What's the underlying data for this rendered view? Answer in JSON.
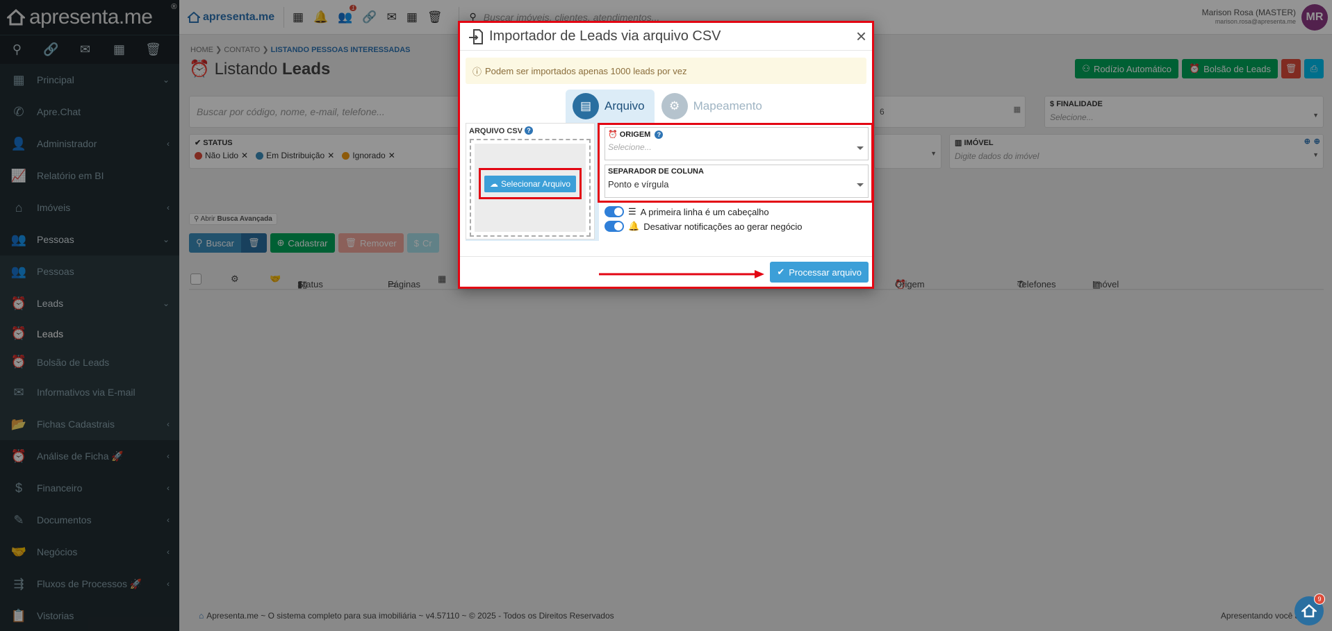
{
  "brand": {
    "name": "apresenta.me",
    "reg": "®"
  },
  "sidebar": {
    "tools": [
      "search-icon",
      "link-icon",
      "mail-icon",
      "calendar-icon",
      "trash-icon"
    ],
    "items": [
      {
        "label": "Principal",
        "icon": "dashboard-icon"
      },
      {
        "label": "Apre.Chat",
        "icon": "whatsapp-icon"
      },
      {
        "label": "Administrador",
        "icon": "user-icon"
      },
      {
        "label": "Relatório em BI",
        "icon": "chart-icon"
      },
      {
        "label": "Imóveis",
        "icon": "home-icon"
      },
      {
        "label": "Pessoas",
        "icon": "people-icon"
      },
      {
        "label": "Pessoas",
        "icon": "people-icon"
      },
      {
        "label": "Leads",
        "icon": "alarm-icon"
      },
      {
        "label": "Leads",
        "icon": "alarm-icon"
      },
      {
        "label": "Bolsão de Leads",
        "icon": "alarm-icon"
      },
      {
        "label": "Informativos via E-mail",
        "icon": "mail-icon"
      },
      {
        "label": "Fichas Cadastrais",
        "icon": "folder-icon"
      },
      {
        "label": "Análise de Ficha 🚀",
        "icon": "alarm-icon"
      },
      {
        "label": "Financeiro",
        "icon": "dollar-icon"
      },
      {
        "label": "Documentos",
        "icon": "document-icon"
      },
      {
        "label": "Negócios",
        "icon": "handshake-icon"
      },
      {
        "label": "Fluxos de Processos 🚀",
        "icon": "flow-icon"
      },
      {
        "label": "Vistorias",
        "icon": "clipboard-icon"
      }
    ]
  },
  "topbar": {
    "logo": "apresenta.me",
    "notif_badge": "1",
    "search_placeholder": "Buscar imóveis, clientes, atendimentos...",
    "user_name": "Marison Rosa (MASTER)",
    "user_email": "marison.rosa@apresenta.me",
    "avatar": "MR"
  },
  "page": {
    "breadcrumb": [
      "HOME",
      "CONTATO",
      "LISTANDO PESSOAS INTERESSADAS"
    ],
    "title_prefix": "Listando",
    "title_bold": "Leads",
    "rodizio": "Rodízio Automático",
    "bolsao": "Bolsão de Leads",
    "search_placeholder": "Buscar por código, nome, e-mail, telefone...",
    "finalidade_label": "FINALIDADE",
    "finalidade_placeholder": "Selecione...",
    "status_label": "STATUS",
    "status_chips": [
      {
        "label": "Não Lido",
        "color": "#dd4b39"
      },
      {
        "label": "Em Distribuição",
        "color": "#3c8dbc"
      },
      {
        "label": "Ignorado",
        "color": "#f39c12"
      }
    ],
    "imovel_label": "IMÓVEL",
    "imovel_placeholder": "Digite dados do imóvel",
    "date_fragment": "6",
    "advanced_prefix": "Abrir",
    "advanced_bold": "Busca Avançada",
    "btn_buscar": "Buscar",
    "btn_cadastrar": "Cadastrar",
    "btn_remover": "Remover",
    "btn_partial": "Cr",
    "columns": [
      "Status",
      "Páginas",
      "Origem",
      "Telefones",
      "Imóvel"
    ],
    "footer_left": "Apresenta.me ~ O sistema completo para sua imobiliária ~ v4.57110 ~ © 2025 - Todos os Direitos Reservados",
    "footer_right": "Apresentando você ao mu",
    "help_badge": "9"
  },
  "modal": {
    "title": "Importador de Leads via arquivo CSV",
    "close": "×",
    "alert": "Podem ser importados apenas 1000 leads por vez",
    "tab_arquivo": "Arquivo",
    "tab_mapeamento": "Mapeamento",
    "csv_label": "ARQUIVO CSV",
    "select_file": "Selecionar Arquivo",
    "origem_label": "ORIGEM",
    "origem_placeholder": "Selecione...",
    "separador_label": "SEPARADOR DE COLUNA",
    "separador_value": "Ponto e vírgula",
    "toggle_header": "A primeira linha é um cabeçalho",
    "toggle_notif": "Desativar notificações ao gerar negócio",
    "process": "Processar arquivo"
  },
  "colors": {
    "sidebar": "#222d32",
    "accent": "#3c9fd8",
    "highlight": "#e30613",
    "green": "#00a65a"
  }
}
